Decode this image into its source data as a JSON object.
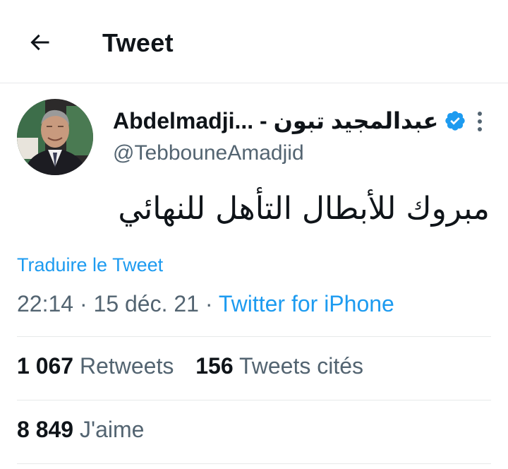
{
  "header": {
    "title": "Tweet",
    "back_icon": "arrow-left-icon"
  },
  "tweet": {
    "author": {
      "display_name": "Abdelmadji... - عبدالمجيد تبون",
      "handle": "@TebbouneAmadjid",
      "verified": true
    },
    "text": "مبروك للأبطال التأهل للنهائي",
    "translate_label": "Traduire le Tweet",
    "time": "22:14",
    "separator": "·",
    "date": "15 déc. 21",
    "source": "Twitter for iPhone"
  },
  "stats": {
    "retweets": {
      "count": "1 067",
      "label": "Retweets"
    },
    "quotes": {
      "count": "156",
      "label": "Tweets cités"
    },
    "likes": {
      "count": "8 849",
      "label": "J'aime"
    }
  },
  "colors": {
    "accent": "#1d9bf0",
    "secondary_text": "#536471",
    "divider": "#e7e9ea"
  }
}
